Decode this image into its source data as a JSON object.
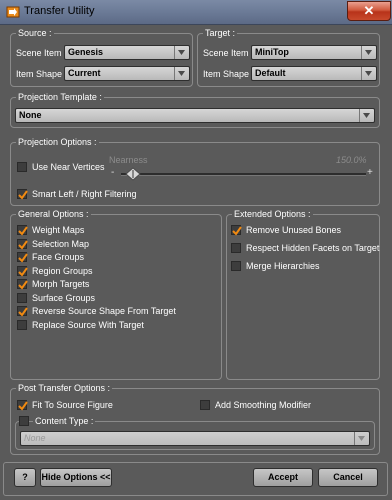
{
  "window": {
    "title": "Transfer Utility",
    "close_glyph": "✕"
  },
  "source": {
    "group_title": "Source :",
    "scene_item_label": "Scene Item :",
    "scene_item_value": "Genesis",
    "item_shape_label": "Item Shape :",
    "item_shape_value": "Current"
  },
  "target": {
    "group_title": "Target :",
    "scene_item_label": "Scene Item :",
    "scene_item_value": "MiniTop",
    "item_shape_label": "Item Shape :",
    "item_shape_value": "Default"
  },
  "projection_template": {
    "group_title": "Projection Template :",
    "value": "None"
  },
  "projection_options": {
    "group_title": "Projection Options :",
    "use_near_vertices": {
      "label": "Use Near Vertices",
      "checked": false
    },
    "nearness": {
      "label": "Nearness",
      "value_text": "150.0%",
      "minus": "-",
      "plus": "+",
      "level": 0.0
    },
    "smart_filtering": {
      "label": "Smart Left / Right Filtering",
      "checked": true
    }
  },
  "general_options": {
    "group_title": "General Options :",
    "items": [
      {
        "label": "Weight Maps",
        "checked": true
      },
      {
        "label": "Selection Map",
        "checked": true
      },
      {
        "label": "Face Groups",
        "checked": true
      },
      {
        "label": "Region Groups",
        "checked": true
      },
      {
        "label": "Morph Targets",
        "checked": true
      },
      {
        "label": "Surface Groups",
        "checked": false
      },
      {
        "label": "Reverse Source Shape From Target",
        "checked": true
      },
      {
        "label": "Replace Source With Target",
        "checked": false
      }
    ]
  },
  "extended_options": {
    "group_title": "Extended Options :",
    "items": [
      {
        "label": "Remove Unused Bones",
        "checked": true
      },
      {
        "label": "Respect Hidden Facets on Target",
        "checked": false
      },
      {
        "label": "Merge Hierarchies",
        "checked": false
      }
    ]
  },
  "post_transfer_options": {
    "group_title": "Post Transfer Options :",
    "fit_to_source": {
      "label": "Fit To Source Figure",
      "checked": true
    },
    "add_smoothing": {
      "label": "Add Smoothing Modifier",
      "checked": false
    },
    "content_type": {
      "label": "Content Type :",
      "checked": false,
      "value": "None"
    }
  },
  "footer": {
    "help_glyph": "?",
    "hide_options_label": "Hide Options <<",
    "accept_label": "Accept",
    "cancel_label": "Cancel"
  },
  "colors": {
    "check_orange": "#f08a12",
    "title_bar": "#6d7c98",
    "close_red": "#c8492c",
    "panel_bg": "#5a5a5a"
  },
  "icons": {
    "app": "transfer-utility-icon",
    "close": "close-icon",
    "dropdown": "chevron-down-icon",
    "checkmark": "checkmark-icon",
    "help": "help-icon",
    "slider_handle": "slider-handle-icon"
  }
}
